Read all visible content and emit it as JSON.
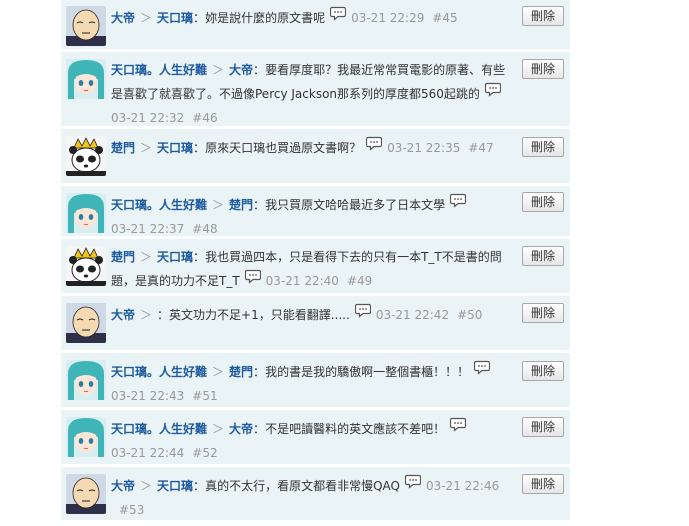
{
  "delete_label": "刪除",
  "separator": "＞",
  "comments": [
    {
      "avatar": "bald-hero",
      "author": "大帝",
      "reply_to": "天口璃",
      "text": "妳是說什麼的原文書呢",
      "time": "03-21 22:29",
      "num": "#45"
    },
    {
      "avatar": "teal-hair-girl",
      "author": "天口璃。人生好難",
      "reply_to": "大帝",
      "text": "要看厚度耶？我最近常常買電影的原著、有些是喜歡了就喜歡了。不過像Percy Jackson那系列的厚度都560起跳的",
      "time": "03-21 22:32",
      "num": "#46"
    },
    {
      "avatar": "panda-king",
      "author": "楚門",
      "reply_to": "天口璃",
      "text": "原來天口璃也買過原文書啊？",
      "time": "03-21 22:35",
      "num": "#47"
    },
    {
      "avatar": "teal-hair-girl",
      "author": "天口璃。人生好難",
      "reply_to": "楚門",
      "text": "我只買原文哈哈最近多了日本文學",
      "time": "03-21 22:37",
      "num": "#48"
    },
    {
      "avatar": "panda-king",
      "author": "楚門",
      "reply_to": "天口璃",
      "text": "我也買過四本，只是看得下去的只有一本T_T不是書的問題，是真的功力不足T_T",
      "time": "03-21 22:40",
      "num": "#49"
    },
    {
      "avatar": "bald-hero",
      "author": "大帝",
      "reply_to": "",
      "text": "英文功力不足+1，只能看翻譯.....",
      "time": "03-21 22:42",
      "num": "#50"
    },
    {
      "avatar": "teal-hair-girl",
      "author": "天口璃。人生好難",
      "reply_to": "楚門",
      "text": "我的書是我的驕傲啊一整個書櫃！！！",
      "time": "03-21 22:43",
      "num": "#51"
    },
    {
      "avatar": "teal-hair-girl",
      "author": "天口璃。人生好難",
      "reply_to": "大帝",
      "text": "不是吧讀醫料的英文應該不差吧！",
      "time": "03-21 22:44",
      "num": "#52"
    },
    {
      "avatar": "bald-hero",
      "author": "大帝",
      "reply_to": "天口璃",
      "text": "真的不太行，看原文都看非常慢QAQ",
      "time": "03-21 22:46",
      "num": "#53"
    }
  ]
}
